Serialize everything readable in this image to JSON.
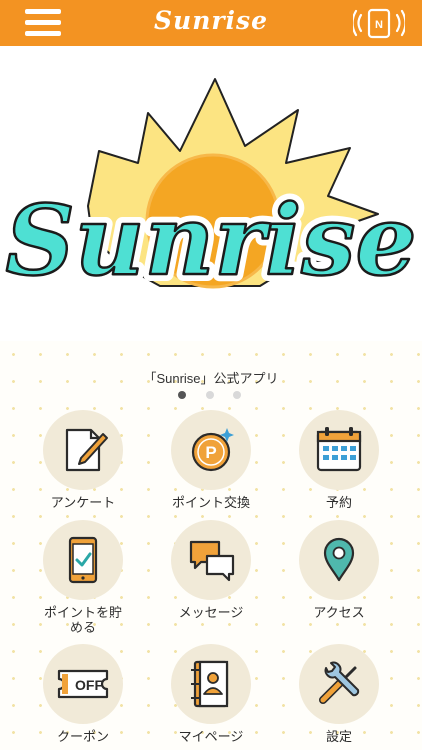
{
  "header": {
    "brand": "Sunrise",
    "background_color": "#f39322",
    "menu_icon": "hamburger-menu-icon",
    "nfc_icon": "nfc-phone-icon",
    "nfc_badge": "N"
  },
  "hero": {
    "logo_text": "Sunrise",
    "logo_text_color": "#4ee0d3",
    "sun_color": "#f4a623",
    "ray_color": "#fce482"
  },
  "carousel": {
    "caption": "「Sunrise」公式アプリ",
    "page_count": 3,
    "active_index": 0
  },
  "menu": {
    "items": [
      {
        "label": "アンケート",
        "icon": "survey-edit-icon"
      },
      {
        "label": "ポイント交換",
        "icon": "point-exchange-icon",
        "icon_text": "P"
      },
      {
        "label": "予約",
        "icon": "calendar-icon"
      },
      {
        "label": "ポイントを貯める",
        "icon": "smartphone-check-icon"
      },
      {
        "label": "メッセージ",
        "icon": "chat-bubbles-icon"
      },
      {
        "label": "アクセス",
        "icon": "map-pin-icon"
      },
      {
        "label": "クーポン",
        "icon": "coupon-ticket-icon",
        "icon_text": "OFF"
      },
      {
        "label": "マイページ",
        "icon": "profile-book-icon"
      },
      {
        "label": "設定",
        "icon": "wrench-screwdriver-icon"
      }
    ]
  }
}
